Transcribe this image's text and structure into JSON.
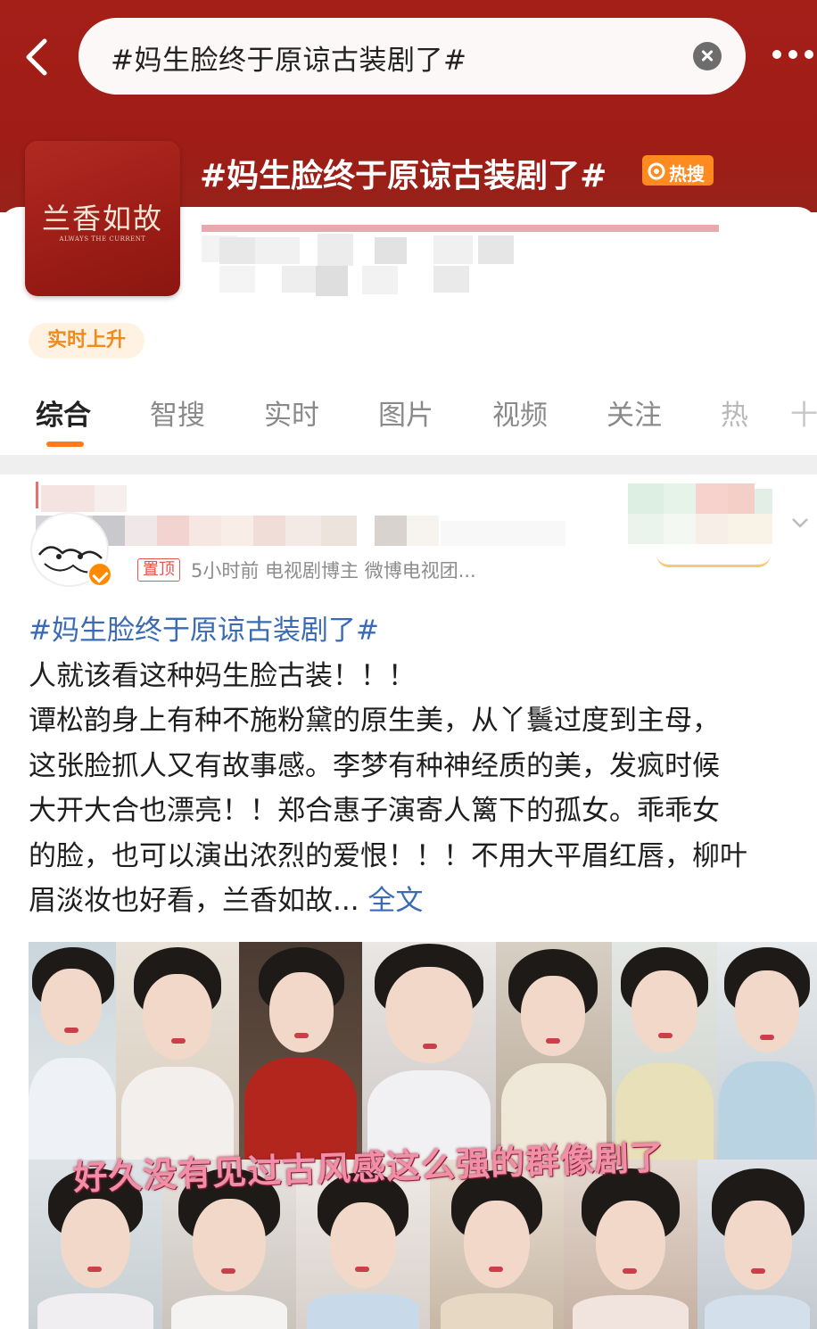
{
  "header": {
    "search_query": "#妈生脸终于原谅古装剧了#",
    "back_icon": "back-arrow-icon",
    "more_icon": "more-dots-icon"
  },
  "topic": {
    "cover_title": "兰香如故",
    "cover_subtitle": "ALWAYS THE CURRENT",
    "title": "#妈生脸终于原谅古装剧了#",
    "hot_badge": "热搜",
    "rising_label": "实时上升"
  },
  "tabs": [
    "综合",
    "智搜",
    "实时",
    "图片",
    "视频",
    "关注",
    "热",
    "十"
  ],
  "active_tab": 0,
  "post": {
    "pinned_label": "置顶",
    "meta": "5小时前  电视剧博主 微博电视团...",
    "hashtag": "#妈生脸终于原谅古装剧了#",
    "lines": [
      "人就该看这种妈生脸古装！！！",
      "谭松韵身上有种不施粉黛的原生美，从丫鬟过度到主母，",
      "这张脸抓人又有故事感。李梦有种神经质的美，发疯时候",
      "大开大合也漂亮！！郑合惠子演寄人篱下的孤女。乖乖女",
      "的脸，也可以演出浓烈的爱恨！！！不用大平眉红唇，柳叶"
    ],
    "last_line": "眉淡妆也好看，兰香如故...",
    "full_text_link": "全文",
    "image_caption": "好久没有见过古风感这么强的群像剧了",
    "accent_color": "#3a6bb4",
    "brand_red": "#a41f18",
    "orange": "#ff7a1b"
  }
}
